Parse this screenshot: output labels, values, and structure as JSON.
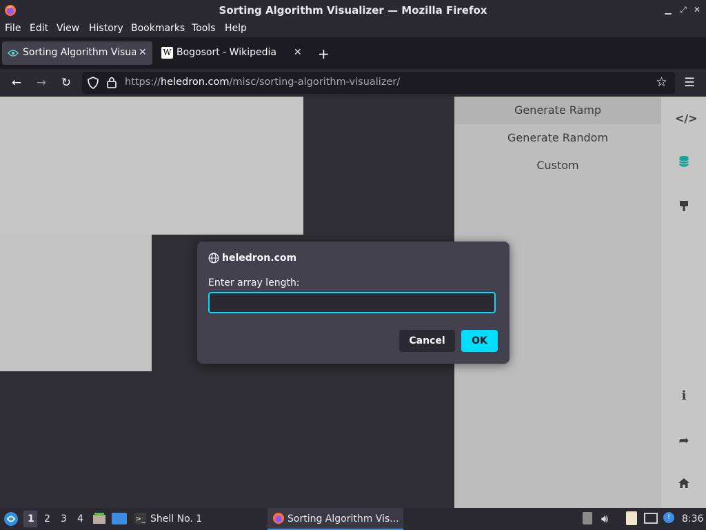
{
  "window": {
    "title": "Sorting Algorithm Visualizer — Mozilla Firefox"
  },
  "menu": [
    "File",
    "Edit",
    "View",
    "History",
    "Bookmarks",
    "Tools",
    "Help"
  ],
  "tabs": [
    {
      "label": "Sorting Algorithm Visualizer",
      "active": true
    },
    {
      "label": "Bogosort - Wikipedia",
      "active": false
    }
  ],
  "url": {
    "prefix": "https://",
    "domain": "heledron.com",
    "path": "/misc/sorting-algorithm-visualizer/"
  },
  "sidepanel": {
    "items": [
      "Generate Ramp",
      "Generate Random",
      "Custom"
    ]
  },
  "dialog": {
    "host": "heledron.com",
    "message": "Enter array length:",
    "input_value": "",
    "cancel_label": "Cancel",
    "ok_label": "OK"
  },
  "taskbar": {
    "workspaces": [
      "1",
      "2",
      "3",
      "4"
    ],
    "shell_label": "Shell No. 1",
    "firefox_label": "Sorting Algorithm Vis...",
    "clock": "8:36"
  },
  "colors": {
    "accent": "#00ddff",
    "dialog_bg": "#42414d",
    "page_bg": "#2f2f33",
    "bar_fill": "#c3c3c3"
  }
}
